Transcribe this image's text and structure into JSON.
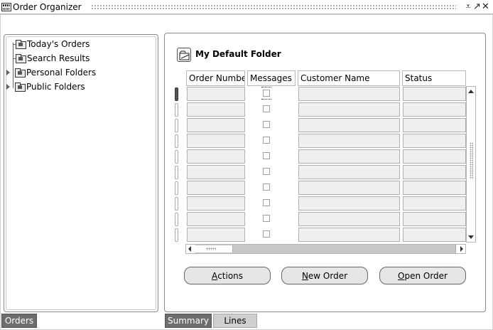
{
  "window": {
    "title": "Order Organizer",
    "controls": [
      "minimize",
      "restore",
      "close"
    ]
  },
  "tree": {
    "items": [
      {
        "label": "Today's Orders",
        "icon": "folder-orders-icon",
        "expandable": false
      },
      {
        "label": "Search Results",
        "icon": "folder-search-icon",
        "expandable": false
      },
      {
        "label": "Personal Folders",
        "icon": "folder-personal-icon",
        "expandable": true
      },
      {
        "label": "Public Folders",
        "icon": "folder-public-icon",
        "expandable": true
      }
    ]
  },
  "left_tabs": {
    "orders": "Orders"
  },
  "right_tabs": {
    "summary": "Summary",
    "lines": "Lines"
  },
  "folder": {
    "title": "My Default Folder"
  },
  "table": {
    "columns": [
      "Order Number",
      "Messages",
      "Customer Name",
      "Status"
    ],
    "row_count": 10,
    "current_row": 0
  },
  "buttons": {
    "actions": {
      "mnemonic": "A",
      "rest": "ctions"
    },
    "new_order": {
      "mnemonic": "N",
      "rest": "ew Order"
    },
    "open_order": {
      "mnemonic": "O",
      "rest": "pen Order"
    }
  }
}
